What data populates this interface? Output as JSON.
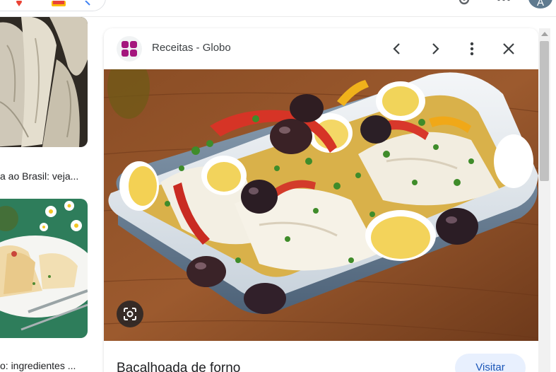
{
  "left_results": [
    {
      "caption": "a ao Brasil: veja...",
      "image": "dried-salted-cod-image"
    },
    {
      "caption": "o: ingredientes ...",
      "image": "cod-dish-with-daisies-image"
    }
  ],
  "preview": {
    "site_name": "Receitas - Globo",
    "title": "Bacalhoada de forno",
    "visit_label": "Visitar",
    "image": "baked-cod-casserole-image"
  },
  "header": {
    "avatar_initial": "A"
  },
  "colors": {
    "visit_button_bg": "#e8f0fe",
    "visit_button_text": "#1a56b8",
    "site_logo": "#a4167d"
  }
}
